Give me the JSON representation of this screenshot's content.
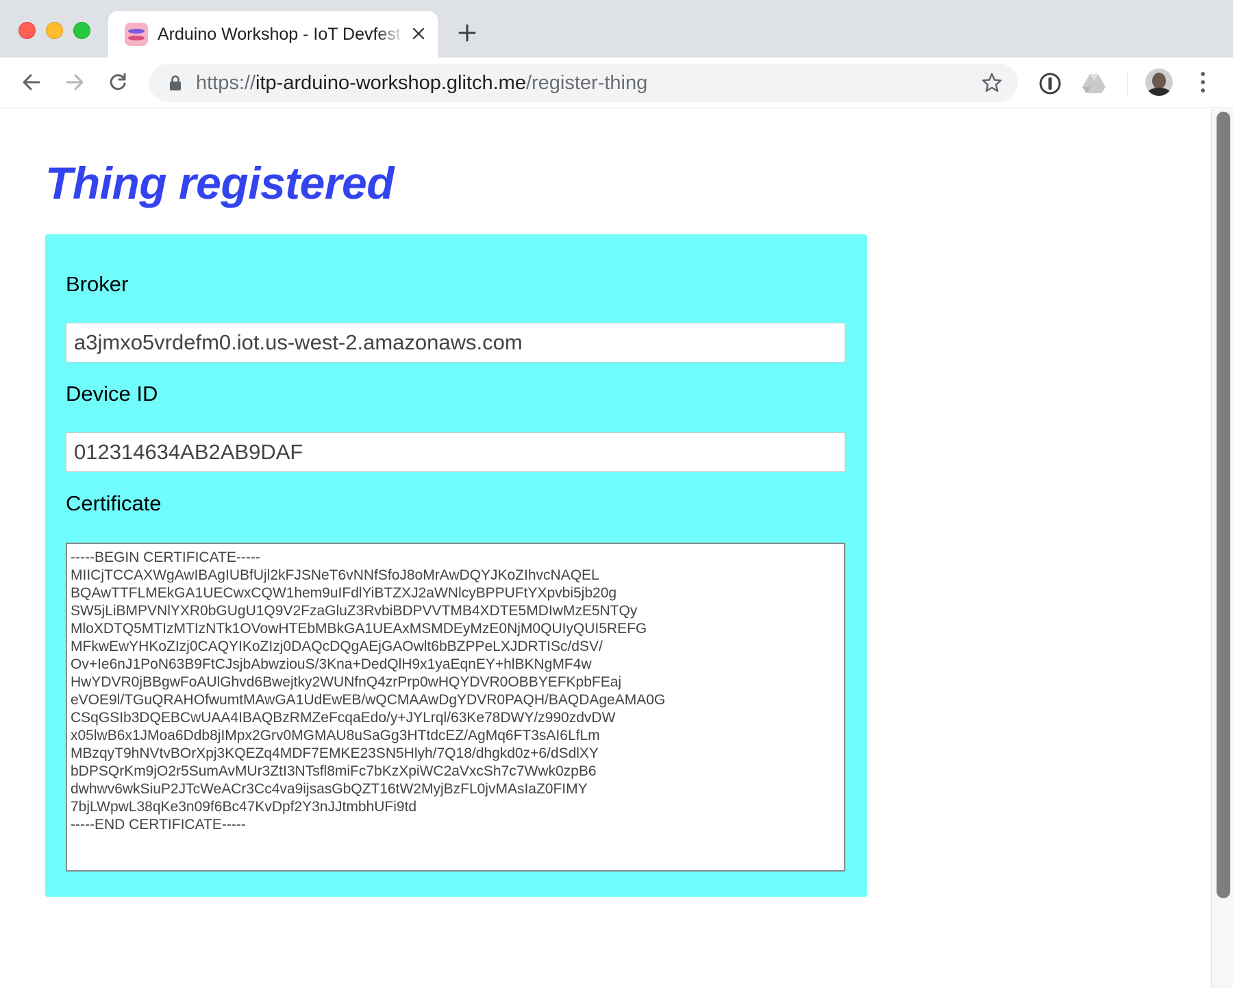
{
  "browser": {
    "tab": {
      "title": "Arduino Workshop - IoT Devfest",
      "favicon": "glitch-fish-icon"
    },
    "address_bar": {
      "scheme": "https://",
      "host": "itp-arduino-workshop.glitch.me",
      "path": "/register-thing"
    },
    "icons": {
      "back": "arrow-left-icon",
      "forward": "arrow-right-icon",
      "reload": "reload-icon",
      "lock": "lock-icon",
      "bookmark": "star-icon",
      "extension_1password": "1password-icon",
      "extension_drive": "google-drive-icon",
      "profile": "avatar",
      "menu": "kebab-menu-icon",
      "new_tab": "plus-icon",
      "close_tab": "close-icon"
    }
  },
  "page": {
    "heading": "Thing registered",
    "heading_color": "#3344ee",
    "panel_color": "#6ffcfb",
    "fields": {
      "broker": {
        "label": "Broker",
        "value": "a3jmxo5vrdefm0.iot.us-west-2.amazonaws.com"
      },
      "device_id": {
        "label": "Device ID",
        "value": "012314634AB2AB9DAF"
      },
      "certificate": {
        "label": "Certificate",
        "value": "-----BEGIN CERTIFICATE-----\nMIICjTCCAXWgAwIBAgIUBfUjl2kFJSNeT6vNNfSfoJ8oMrAwDQYJKoZIhvcNAQEL\nBQAwTTFLMEkGA1UECwxCQW1hem9uIFdlYiBTZXJ2aWNlcyBPPUFtYXpvbi5jb20g\nSW5jLiBMPVNlYXR0bGUgU1Q9V2FzaGluZ3RvbiBDPVVTMB4XDTE5MDIwMzE5NTQy\nMloXDTQ5MTIzMTIzNTk1OVowHTEbMBkGA1UEAxMSMDEyMzE0NjM0QUIyQUI5REFG\nMFkwEwYHKoZIzj0CAQYIKoZIzj0DAQcDQgAEjGAOwlt6bBZPPeLXJDRTISc/dSV/\nOv+Ie6nJ1PoN63B9FtCJsjbAbwziouS/3Kna+DedQlH9x1yaEqnEY+hlBKNgMF4w\nHwYDVR0jBBgwFoAUlGhvd6Bwejtky2WUNfnQ4zrPrp0wHQYDVR0OBBYEFKpbFEaj\neVOE9l/TGuQRAHOfwumtMAwGA1UdEwEB/wQCMAAwDgYDVR0PAQH/BAQDAgeAMA0G\nCSqGSIb3DQEBCwUAA4IBAQBzRMZeFcqaEdo/y+JYLrql/63Ke78DWY/z990zdvDW\nx05lwB6x1JMoa6Ddb8jIMpx2Grv0MGMAU8uSaGg3HTtdcEZ/AgMq6FT3sAI6LfLm\nMBzqyT9hNVtvBOrXpj3KQEZq4MDF7EMKE23SN5Hlyh/7Q18/dhgkd0z+6/dSdlXY\nbDPSQrKm9jO2r5SumAvMUr3ZtI3NTsfl8miFc7bKzXpiWC2aVxcSh7c7Wwk0zpB6\ndwhwv6wkSiuP2JTcWeACr3Cc4va9ijsasGbQZT16tW2MyjBzFL0jvMAsIaZ0FIMY\n7bjLWpwL38qKe3n09f6Bc47KvDpf2Y3nJJtmbhUFi9td\n-----END CERTIFICATE-----"
      }
    }
  }
}
